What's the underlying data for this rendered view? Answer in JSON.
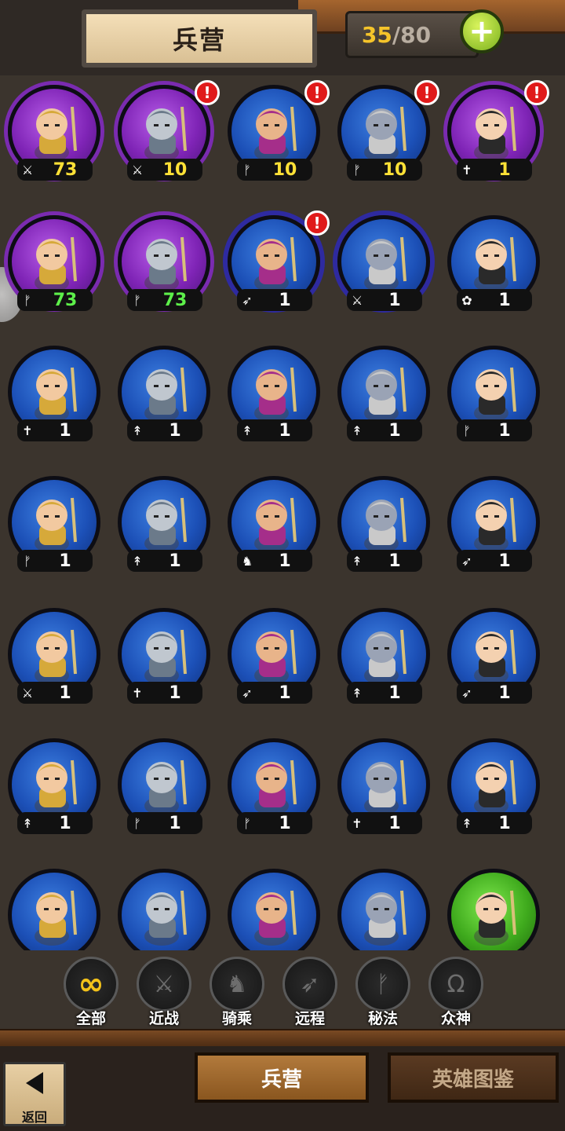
{
  "header": {
    "title": "兵营",
    "count_current": "35",
    "count_sep": "/",
    "count_max": "80",
    "add_icon": "plus-icon"
  },
  "units": [
    {
      "color": "purple",
      "cls": "sword",
      "level": "73",
      "lvcolor": "yellow",
      "alert": false
    },
    {
      "color": "purple",
      "cls": "sword",
      "level": "10",
      "lvcolor": "yellow",
      "alert": true
    },
    {
      "color": "blue",
      "cls": "magic",
      "level": "10",
      "lvcolor": "yellow",
      "alert": true
    },
    {
      "color": "blue",
      "cls": "magic",
      "level": "10",
      "lvcolor": "yellow",
      "alert": true
    },
    {
      "color": "purple",
      "cls": "holy",
      "level": "1",
      "lvcolor": "yellow",
      "alert": true
    },
    {
      "color": "purple",
      "cls": "magic",
      "level": "73",
      "lvcolor": "green",
      "alert": false
    },
    {
      "color": "purple",
      "cls": "magic",
      "level": "73",
      "lvcolor": "green",
      "alert": false
    },
    {
      "color": "blue",
      "cls": "bow",
      "level": "1",
      "lvcolor": "white",
      "alert": true,
      "spiky": true
    },
    {
      "color": "blue",
      "cls": "sword",
      "level": "1",
      "lvcolor": "white",
      "alert": false,
      "spiky": true
    },
    {
      "color": "blue",
      "cls": "beast",
      "level": "1",
      "lvcolor": "white",
      "alert": false
    },
    {
      "color": "blue",
      "cls": "holy",
      "level": "1",
      "lvcolor": "white",
      "alert": false
    },
    {
      "color": "blue",
      "cls": "spear",
      "level": "1",
      "lvcolor": "white",
      "alert": false
    },
    {
      "color": "blue",
      "cls": "spear",
      "level": "1",
      "lvcolor": "white",
      "alert": false
    },
    {
      "color": "blue",
      "cls": "spear",
      "level": "1",
      "lvcolor": "white",
      "alert": false
    },
    {
      "color": "blue",
      "cls": "magic",
      "level": "1",
      "lvcolor": "white",
      "alert": false
    },
    {
      "color": "blue",
      "cls": "magic",
      "level": "1",
      "lvcolor": "white",
      "alert": false
    },
    {
      "color": "blue",
      "cls": "spear",
      "level": "1",
      "lvcolor": "white",
      "alert": false
    },
    {
      "color": "blue",
      "cls": "mount",
      "level": "1",
      "lvcolor": "white",
      "alert": false
    },
    {
      "color": "blue",
      "cls": "spear",
      "level": "1",
      "lvcolor": "white",
      "alert": false
    },
    {
      "color": "blue",
      "cls": "bow",
      "level": "1",
      "lvcolor": "white",
      "alert": false
    },
    {
      "color": "blue",
      "cls": "sword",
      "level": "1",
      "lvcolor": "white",
      "alert": false
    },
    {
      "color": "blue",
      "cls": "holy",
      "level": "1",
      "lvcolor": "white",
      "alert": false
    },
    {
      "color": "blue",
      "cls": "bow",
      "level": "1",
      "lvcolor": "white",
      "alert": false
    },
    {
      "color": "blue",
      "cls": "spear",
      "level": "1",
      "lvcolor": "white",
      "alert": false
    },
    {
      "color": "blue",
      "cls": "bow",
      "level": "1",
      "lvcolor": "white",
      "alert": false
    },
    {
      "color": "blue",
      "cls": "spear",
      "level": "1",
      "lvcolor": "white",
      "alert": false
    },
    {
      "color": "blue",
      "cls": "magic",
      "level": "1",
      "lvcolor": "white",
      "alert": false
    },
    {
      "color": "blue",
      "cls": "magic",
      "level": "1",
      "lvcolor": "white",
      "alert": false
    },
    {
      "color": "blue",
      "cls": "holy",
      "level": "1",
      "lvcolor": "white",
      "alert": false
    },
    {
      "color": "blue",
      "cls": "spear",
      "level": "1",
      "lvcolor": "white",
      "alert": false
    },
    {
      "color": "blue",
      "cls": "",
      "level": "",
      "lvcolor": "white",
      "alert": false
    },
    {
      "color": "blue",
      "cls": "",
      "level": "",
      "lvcolor": "white",
      "alert": false
    },
    {
      "color": "blue",
      "cls": "",
      "level": "",
      "lvcolor": "white",
      "alert": false
    },
    {
      "color": "blue",
      "cls": "",
      "level": "",
      "lvcolor": "white",
      "alert": false
    },
    {
      "color": "green",
      "cls": "",
      "level": "",
      "lvcolor": "white",
      "alert": false
    }
  ],
  "alert_mark": "!",
  "class_glyphs": {
    "sword": "⚔",
    "magic": "ᚠ",
    "holy": "✝",
    "bow": "➶",
    "beast": "✿",
    "spear": "↟",
    "mount": "♞"
  },
  "filters": [
    {
      "icon": "∞",
      "label": "全部",
      "active": true,
      "name": "all"
    },
    {
      "icon": "⚔",
      "label": "近战",
      "active": false,
      "name": "melee"
    },
    {
      "icon": "♞",
      "label": "骑乘",
      "active": false,
      "name": "mounted"
    },
    {
      "icon": "➶",
      "label": "远程",
      "active": false,
      "name": "ranged"
    },
    {
      "icon": "ᚠ",
      "label": "秘法",
      "active": false,
      "name": "arcane"
    },
    {
      "icon": "Ω",
      "label": "众神",
      "active": false,
      "name": "gods"
    }
  ],
  "tabs": {
    "barracks": "兵营",
    "codex": "英雄图鉴"
  },
  "back": {
    "label": "返回"
  },
  "colors": {
    "accent_yellow": "#ffe136",
    "level_green": "#5df04a",
    "plus_green": "#9fd63a",
    "alert_red": "#e01a1a"
  }
}
